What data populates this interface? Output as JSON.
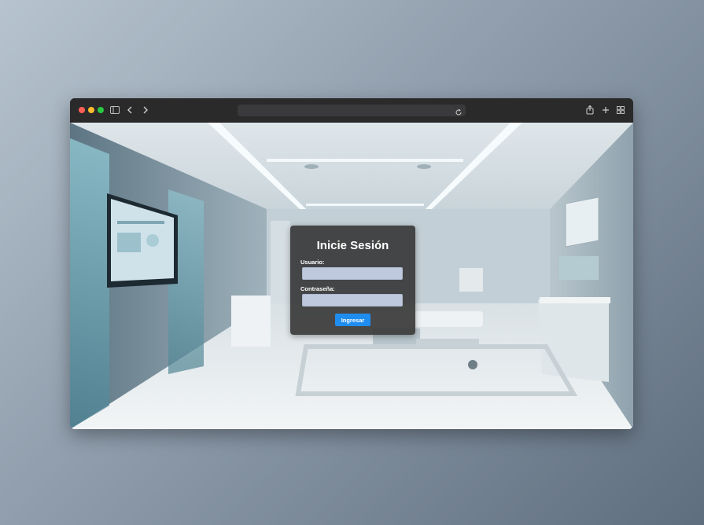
{
  "browser": {
    "address_bar": {
      "value": ""
    },
    "icons": [
      "sidebar-icon",
      "back-icon",
      "forward-icon",
      "reload-icon",
      "share-icon",
      "new-tab-icon",
      "tab-overview-icon"
    ]
  },
  "login": {
    "title": "Inicie Sesión",
    "username_label": "Usuario:",
    "username_value": "",
    "password_label": "Contraseña:",
    "password_value": "",
    "submit_label": "Ingresar"
  },
  "colors": {
    "panel": "#3a3a3a",
    "field": "#bfc9dd",
    "button": "#1f8df0"
  }
}
